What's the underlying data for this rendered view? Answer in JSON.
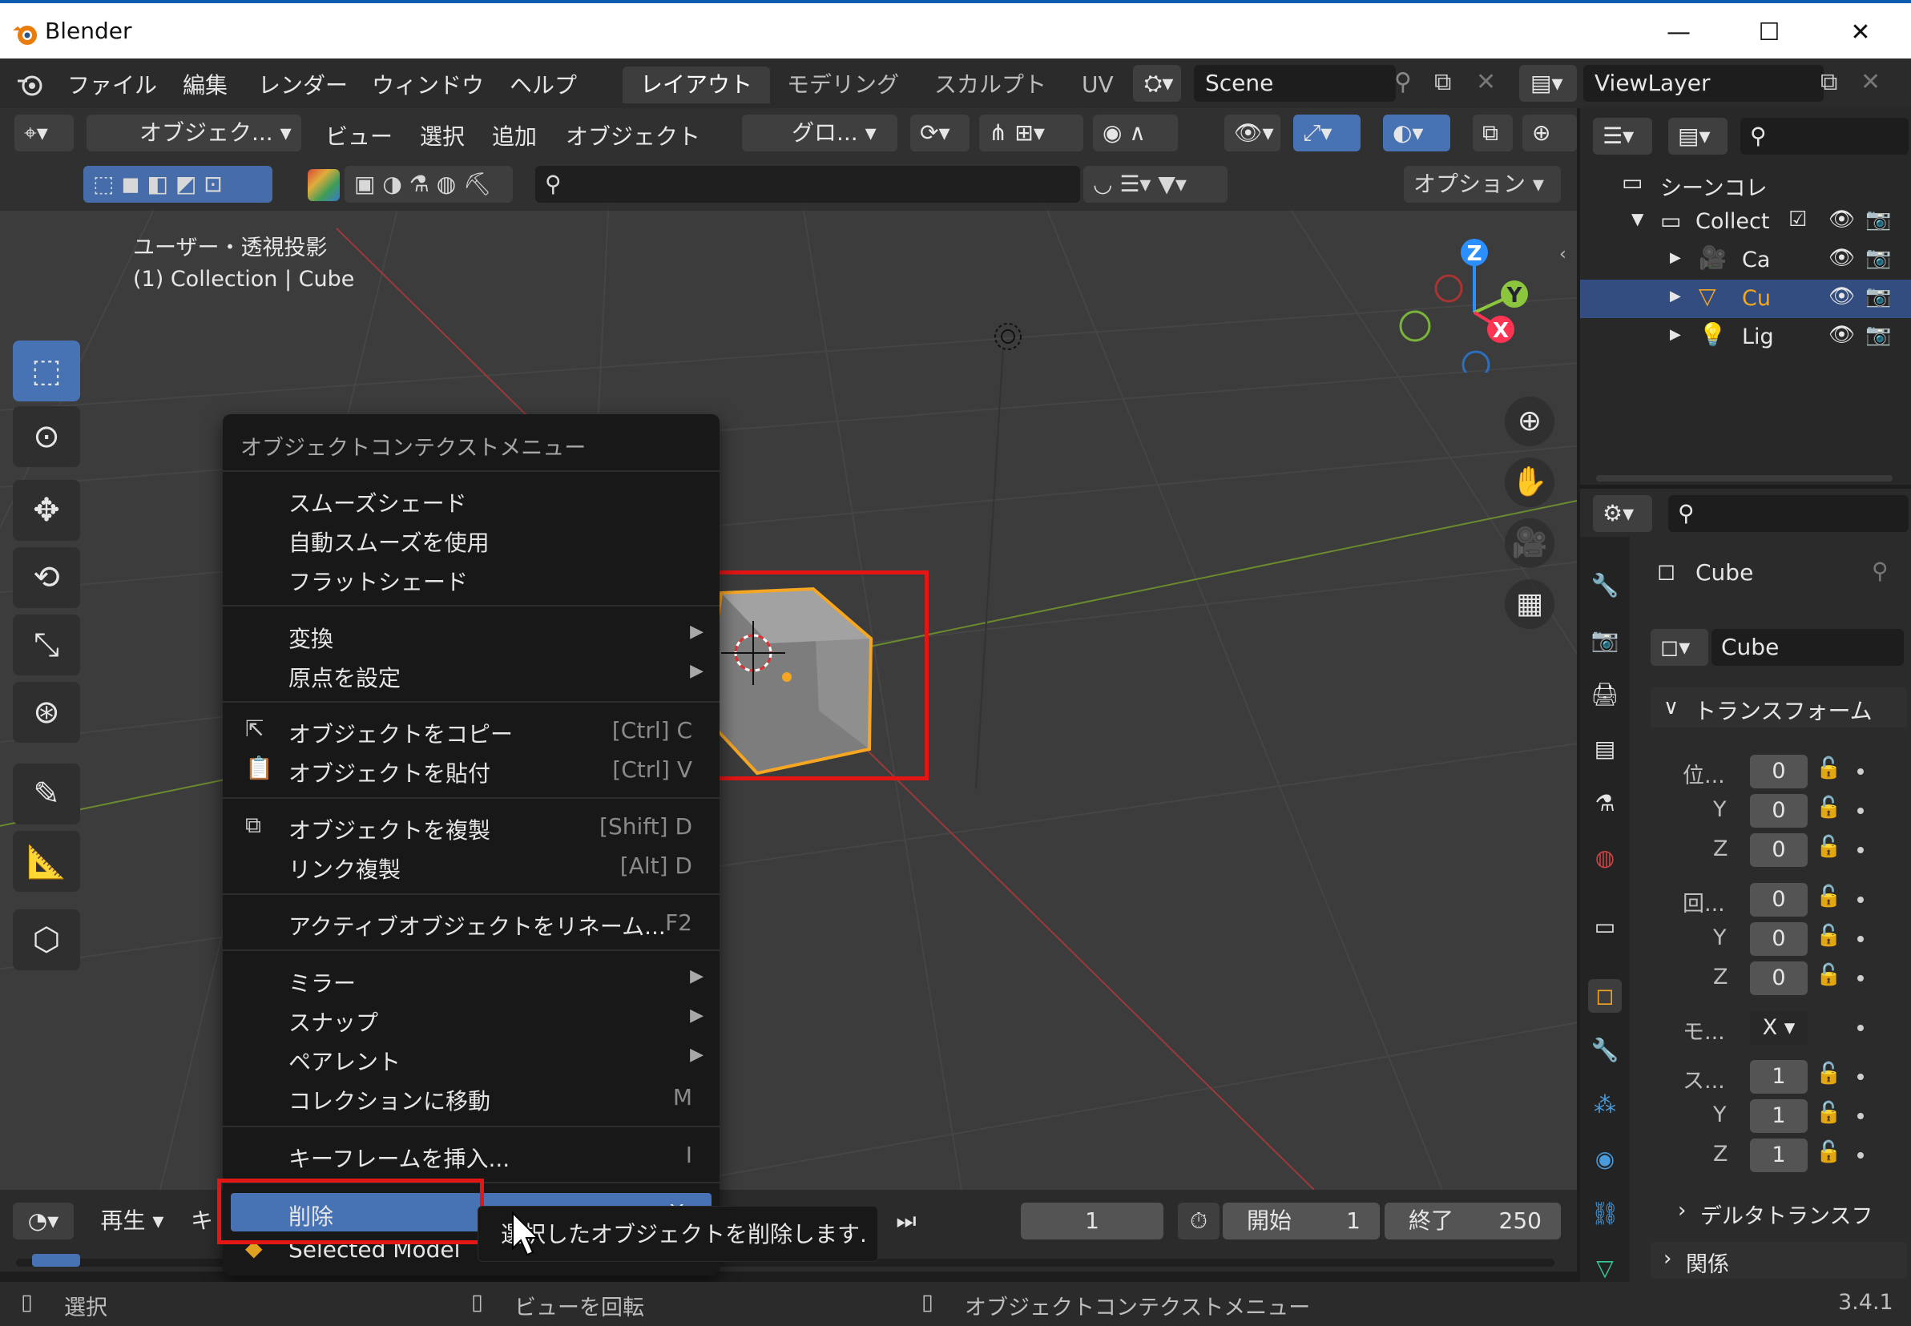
{
  "window": {
    "title": "Blender",
    "minimize": "—",
    "maximize": "☐",
    "close": "✕"
  },
  "menubar": {
    "items": [
      "ファイル",
      "編集",
      "レンダー",
      "ウィンドウ",
      "ヘルプ"
    ],
    "workspaces": [
      "レイアウト",
      "モデリング",
      "スカルプト",
      "UV"
    ],
    "active_workspace": "レイアウト",
    "scene": "Scene",
    "view_layer": "ViewLayer"
  },
  "viewport": {
    "mode": "オブジェク...",
    "menus": [
      "ビュー",
      "選択",
      "追加",
      "オブジェクト"
    ],
    "orientation": "グロ...",
    "options": "オプション",
    "overlay_title": "ユーザー・透視投影",
    "overlay_sub": "(1) Collection | Cube",
    "gizmo": {
      "z": "Z",
      "y": "Y",
      "x": "X"
    }
  },
  "context_menu": {
    "title": "オブジェクトコンテクストメニュー",
    "items": [
      {
        "label": "スムーズシェード",
        "shortcut": ""
      },
      {
        "label": "自動スムーズを使用",
        "shortcut": ""
      },
      {
        "label": "フラットシェード",
        "shortcut": ""
      },
      {
        "label": "変換",
        "shortcut": ""
      },
      {
        "label": "原点を設定",
        "shortcut": ""
      },
      {
        "label": "オブジェクトをコピー",
        "shortcut": "[Ctrl] C"
      },
      {
        "label": "オブジェクトを貼付",
        "shortcut": "[Ctrl] V"
      },
      {
        "label": "オブジェクトを複製",
        "shortcut": "[Shift] D"
      },
      {
        "label": "リンク複製",
        "shortcut": "[Alt] D"
      },
      {
        "label": "アクティブオブジェクトをリネーム...",
        "shortcut": "F2"
      },
      {
        "label": "ミラー",
        "shortcut": ""
      },
      {
        "label": "スナップ",
        "shortcut": ""
      },
      {
        "label": "ペアレント",
        "shortcut": ""
      },
      {
        "label": "コレクションに移動",
        "shortcut": "M"
      },
      {
        "label": "キーフレームを挿入...",
        "shortcut": "I"
      },
      {
        "label": "削除",
        "shortcut": "X"
      },
      {
        "label": "Selected Model",
        "shortcut": ""
      }
    ],
    "tooltip": "選択したオブジェクトを削除します."
  },
  "timeline": {
    "playback": "再生",
    "keying": "キ",
    "current_frame": "1",
    "start_label": "開始",
    "start_value": "1",
    "end_label": "終了",
    "end_value": "250"
  },
  "statusbar": {
    "select": "選択",
    "rotate": "ビューを回転",
    "context": "オブジェクトコンテクストメニュー",
    "version": "3.4.1"
  },
  "outliner": {
    "scene_collection": "シーンコレ",
    "collection": "Collect",
    "objects": [
      "Ca",
      "Cu",
      "Lig"
    ]
  },
  "properties": {
    "object_name": "Cube",
    "data_name": "Cube",
    "transform_header": "トランスフォーム",
    "location_label": "位...",
    "rotation_label": "回...",
    "mode_label": "モ...",
    "mode_value": "X",
    "scale_label": "ス...",
    "y": "Y",
    "z": "Z",
    "loc": [
      "0",
      "0",
      "0"
    ],
    "rot": [
      "0",
      "0",
      "0"
    ],
    "scale": [
      "1",
      "1",
      "1"
    ],
    "delta": "デルタトランスフ",
    "relations": "関係"
  },
  "colors": {
    "accent": "#4772b3",
    "highlight_box": "#e31515",
    "selection_outline": "#f5a623"
  }
}
